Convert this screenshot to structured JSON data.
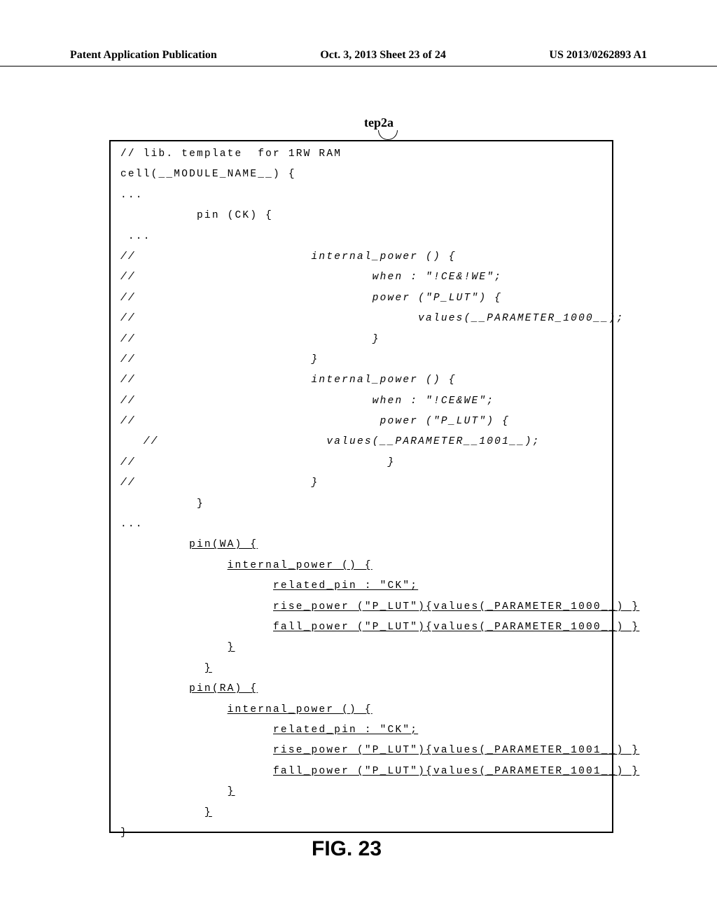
{
  "header": {
    "left": "Patent Application Publication",
    "center": "Oct. 3, 2013  Sheet 23 of 24",
    "right": "US 2013/0262893 A1"
  },
  "label_tep": "tep2a",
  "code": {
    "l1": "// lib. template  for 1RW RAM",
    "l2": "cell(__MODULE_NAME__) {",
    "l3": "...",
    "l4": "          pin (CK) {",
    "l5": " ...",
    "l6": "//                       internal_power () {",
    "l7": "//                               when : \"!CE&!WE\";",
    "l8": "//                               power (\"P_LUT\") {",
    "l9": "//                                     values(__PARAMETER_1000__);",
    "l10": "//                               }",
    "l11": "//                       }",
    "l12": "//                       internal_power () {",
    "l13": "//                               when : \"!CE&WE\";",
    "l14": "//                                power (\"P_LUT\") {",
    "l15": "   //                      values(__PARAMETER__1001__);",
    "l16": "//                                 }",
    "l17": "//                       }",
    "l18": "          }",
    "l19": "...",
    "l20a": "         ",
    "l20b": "pin(WA) {",
    "l21a": "              ",
    "l21b": "internal_power () {",
    "l22a": "                    ",
    "l22b": "related_pin : \"CK\";",
    "l23a": "                    ",
    "l23b": "rise_power (\"P_LUT\"){values(_PARAMETER_1000__) }",
    "l24a": "                    ",
    "l24b": "fall_power (\"P_LUT\"){values(_PARAMETER_1000__) }",
    "l25a": "              ",
    "l25b": "}",
    "l26a": "           ",
    "l26b": "}",
    "l27a": "         ",
    "l27b": "pin(RA) {",
    "l28a": "              ",
    "l28b": "internal_power () {",
    "l29a": "                    ",
    "l29b": "related_pin : \"CK\";",
    "l30a": "                    ",
    "l30b": "rise_power (\"P_LUT\"){values(_PARAMETER_1001__) }",
    "l31a": "                    ",
    "l31b": "fall_power (\"P_LUT\"){values(_PARAMETER_1001__) }",
    "l32a": "              ",
    "l32b": "}",
    "l33a": "           ",
    "l33b": "}",
    "l34": "}"
  },
  "figure_caption": "FIG. 23"
}
